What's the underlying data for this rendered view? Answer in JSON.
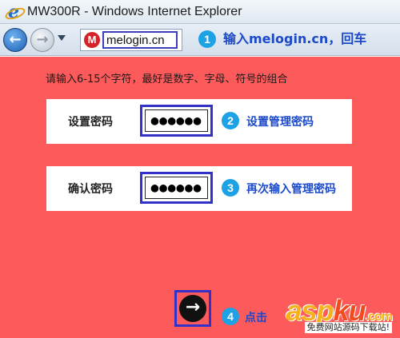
{
  "window": {
    "title": "MW300R - Windows Internet Explorer",
    "icon": "internet-explorer-icon"
  },
  "navbar": {
    "back_icon": "back-arrow-icon",
    "forward_icon": "forward-arrow-icon",
    "address_url": "melogin.cn",
    "favicon_letter": "M",
    "step_number": "1",
    "step_note": "输入melogin.cn，回车"
  },
  "page": {
    "background_color": "#fd5b5b",
    "instruction": "请输入6-15个字符，最好是数字、字母、符号的组合",
    "fields": [
      {
        "label": "设置密码",
        "value": "●●●●●●",
        "step_number": "2",
        "step_note": "设置管理密码"
      },
      {
        "label": "确认密码",
        "value": "●●●●●●",
        "step_number": "3",
        "step_note": "再次输入管理密码"
      }
    ],
    "submit": {
      "icon": "right-arrow-icon",
      "glyph": "→",
      "step_number": "4",
      "step_note": "点击"
    }
  },
  "watermark": {
    "logo_prefix": "asp",
    "logo_suffix": "ku",
    "logo_domain": ".com",
    "caption": "免费网站源码下载站!"
  }
}
